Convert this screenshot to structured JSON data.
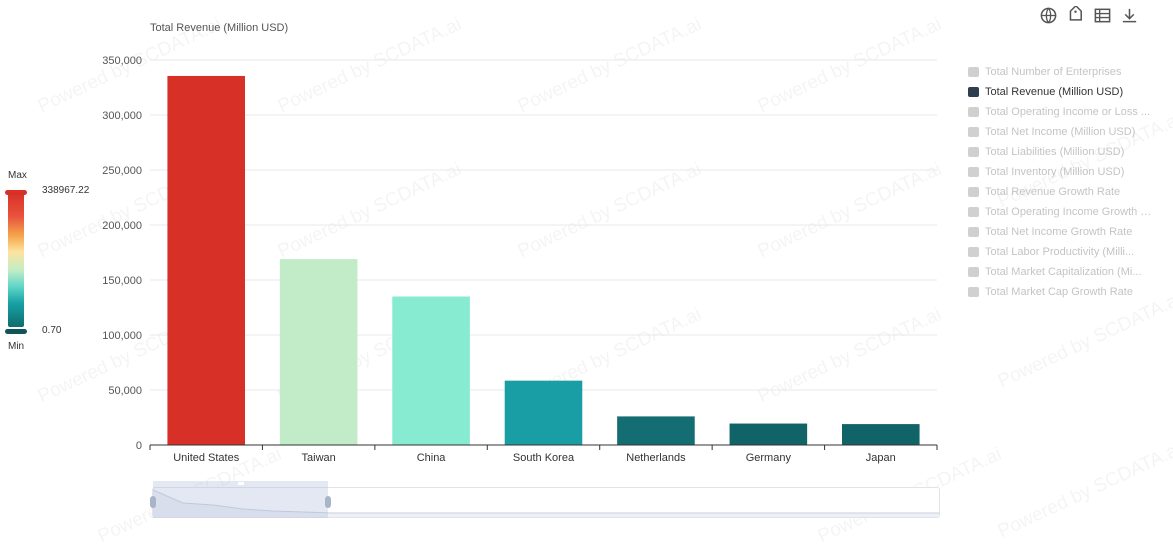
{
  "toolbar": {
    "icons": [
      "globe-icon",
      "tag-icon",
      "data-view-icon",
      "download-icon"
    ]
  },
  "watermark": {
    "text": "Powered by SCDATA.ai"
  },
  "legend": {
    "items": [
      {
        "label": "Total Number of Enterprises",
        "active": false
      },
      {
        "label": "Total Revenue (Million USD)",
        "active": true
      },
      {
        "label": "Total Operating Income or Loss ...",
        "active": false
      },
      {
        "label": "Total Net Income (Million USD)",
        "active": false
      },
      {
        "label": "Total Liabilities (Million USD)",
        "active": false
      },
      {
        "label": "Total Inventory (Million USD)",
        "active": false
      },
      {
        "label": "Total Revenue Growth Rate",
        "active": false
      },
      {
        "label": "Total Operating Income Growth R...",
        "active": false
      },
      {
        "label": "Total Net Income Growth Rate",
        "active": false
      },
      {
        "label": "Total Labor Productivity (Milli...",
        "active": false
      },
      {
        "label": "Total Market Capitalization (Mi...",
        "active": false
      },
      {
        "label": "Total Market Cap Growth Rate",
        "active": false
      }
    ]
  },
  "visual_map": {
    "max_label": "Max",
    "min_label": "Min",
    "max_value": "338967.22",
    "min_value": "0.70",
    "colors": [
      "#d73027",
      "#f4a64a",
      "#fde4a0",
      "#c0ecc7",
      "#5fd5c7",
      "#17a2a6",
      "#0f6c6e"
    ]
  },
  "chart_data": {
    "type": "bar",
    "title": "",
    "ylabel": "Total Revenue (Million USD)",
    "xlabel": "",
    "categories": [
      "United States",
      "Taiwan",
      "China",
      "South Korea",
      "Netherlands",
      "Germany",
      "Japan"
    ],
    "series": [
      {
        "name": "Total Revenue (Million USD)",
        "values": [
          335500,
          169000,
          135000,
          58500,
          26000,
          19500,
          19000
        ],
        "colors": [
          "#d73027",
          "#c2ecc8",
          "#86ebd1",
          "#1a9ea5",
          "#136d73",
          "#106366",
          "#106366"
        ]
      }
    ],
    "ylim": [
      0,
      350000
    ],
    "yticks": [
      "0",
      "50,000",
      "100,000",
      "150,000",
      "200,000",
      "250,000",
      "300,000",
      "350,000"
    ],
    "grid": true,
    "legend": "right"
  }
}
